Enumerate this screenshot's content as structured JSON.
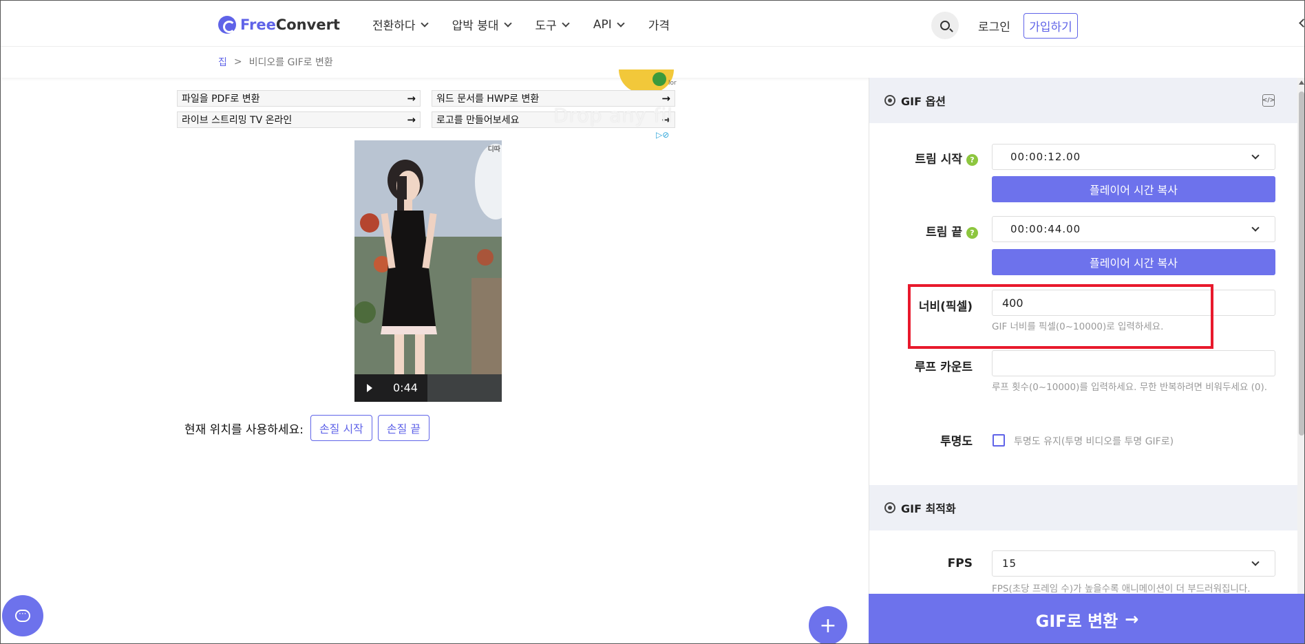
{
  "header": {
    "logo_free": "Free",
    "logo_convert": "Convert",
    "nav": [
      {
        "label": "전환하다"
      },
      {
        "label": "압박 붕대"
      },
      {
        "label": "도구"
      },
      {
        "label": "API"
      },
      {
        "label": "가격"
      }
    ],
    "login": "로그인",
    "signup": "가입하기"
  },
  "breadcrumb": {
    "home": "집",
    "separator": ">",
    "current": "비디오를 GIF로 변환"
  },
  "ad": {
    "links": [
      {
        "label": "파일을 PDF로 변환",
        "arrow": "→"
      },
      {
        "label": "워드 문서를 HWP로 변환",
        "arrow": "→"
      },
      {
        "label": "라이브 스트리밍 TV 온라인",
        "arrow": "→"
      },
      {
        "label": "로고를 만들어보세요",
        "arrow": "→"
      }
    ],
    "mini": "lor",
    "drop_text": "Drop any fil",
    "choices": "▷⊘"
  },
  "video": {
    "corner_text": "디따",
    "time": "0:44"
  },
  "trim_actions": {
    "label": "현재 위치를 사용하세요:",
    "start": "손질 시작",
    "end": "손질 끝"
  },
  "gif_options": {
    "title": "GIF 옵션",
    "code_icon": "</>",
    "trim_start": {
      "label": "트림 시작",
      "help": "?",
      "value": "00:00:12.00",
      "copy": "플레이어 시간 복사"
    },
    "trim_end": {
      "label": "트림 끝",
      "help": "?",
      "value": "00:00:44.00",
      "copy": "플레이어 시간 복사"
    },
    "width": {
      "label": "너비(픽셀)",
      "value": "400",
      "hint": "GIF 너비를 픽셀(0~10000)로 입력하세요."
    },
    "loop": {
      "label": "루프 카운트",
      "value": "",
      "hint": "루프 횟수(0~10000)를 입력하세요. 무한 반복하려면 비워두세요 (0)."
    },
    "transparency": {
      "label": "투명도",
      "option": "투명도 유지(투명 비디오를 투명 GIF로)",
      "checked": false
    }
  },
  "gif_optimize": {
    "title": "GIF 최적화",
    "fps": {
      "label": "FPS",
      "value": "15",
      "hint": "FPS(초당 프레임 수)가 높을수록 애니메이션이 더 부드러워집니다."
    }
  },
  "convert_button": {
    "label": "GIF로 변환",
    "arrow": "→"
  },
  "colors": {
    "accent": "#6d72ec",
    "highlight": "#e8192c",
    "help": "#8dc63f"
  }
}
